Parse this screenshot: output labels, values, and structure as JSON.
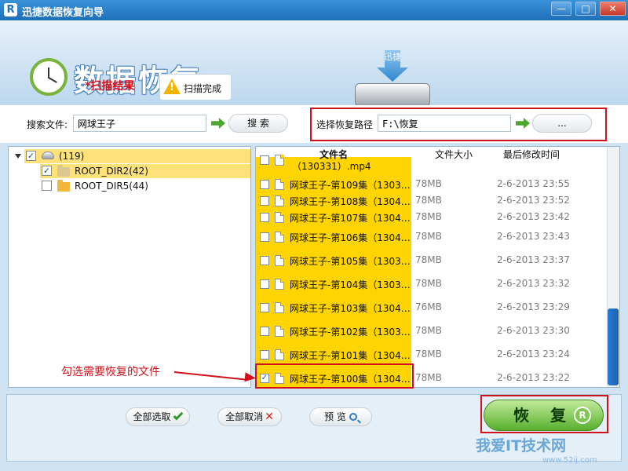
{
  "window": {
    "title": "迅捷数据恢复向导",
    "logo": "R"
  },
  "header": {
    "brand": "数据恢复",
    "scan_result": "*扫描结果",
    "scan_status": "扫描完成",
    "drive_label": "迅捷"
  },
  "search": {
    "label": "搜索文件:",
    "value": "网球王子",
    "button": "搜 索"
  },
  "path": {
    "label": "选择恢复路径",
    "value": "F:\\恢复",
    "browse": "..."
  },
  "tree": [
    {
      "label": "(119)",
      "checked": true
    },
    {
      "label": "ROOT_DIR2(42)",
      "checked": true
    },
    {
      "label": "ROOT_DIR5(44)",
      "checked": false
    }
  ],
  "columns": {
    "name": "文件名",
    "size": "文件大小",
    "date": "最后修改时间"
  },
  "files": [
    {
      "name": "（130331）.mp4",
      "size": "",
      "date": "",
      "checked": false
    },
    {
      "name": "网球王子-第109集（1303…",
      "size": "78MB",
      "date": "2-6-2013 23:55",
      "checked": false
    },
    {
      "name": "网球王子-第108集（1304…",
      "size": "78MB",
      "date": "2-6-2013 23:52",
      "checked": false
    },
    {
      "name": "网球王子-第107集（1304…",
      "size": "78MB",
      "date": "2-6-2013 23:42",
      "checked": false
    },
    {
      "name": "网球王子-第106集（1304…",
      "size": "78MB",
      "date": "2-6-2013 23:43",
      "checked": false
    },
    {
      "name": "网球王子-第105集（1303…",
      "size": "78MB",
      "date": "2-6-2013 23:37",
      "checked": false
    },
    {
      "name": "网球王子-第104集（1303…",
      "size": "78MB",
      "date": "2-6-2013 23:32",
      "checked": false
    },
    {
      "name": "网球王子-第103集（1304…",
      "size": "76MB",
      "date": "2-6-2013 23:29",
      "checked": false
    },
    {
      "name": "网球王子-第102集（1303…",
      "size": "78MB",
      "date": "2-6-2013 23:30",
      "checked": false
    },
    {
      "name": "网球王子-第101集（1304…",
      "size": "78MB",
      "date": "2-6-2013 23:24",
      "checked": false
    },
    {
      "name": "网球王子-第100集（1304…",
      "size": "78MB",
      "date": "2-6-2013 23:22",
      "checked": true
    }
  ],
  "bottom": {
    "select_all": "全部选取",
    "deselect_all": "全部取消",
    "preview": "预 览",
    "recover": "恢 复",
    "recover_icon": "R"
  },
  "annotation": "勾选需要恢复的文件",
  "watermark": {
    "main": "我爱IT技术网",
    "sub": "www.52ij.com"
  },
  "colors": {
    "accent": "#1f6fb8",
    "highlight": "#ffd400",
    "annotation": "#d0101a",
    "recover": "#57b02e"
  }
}
